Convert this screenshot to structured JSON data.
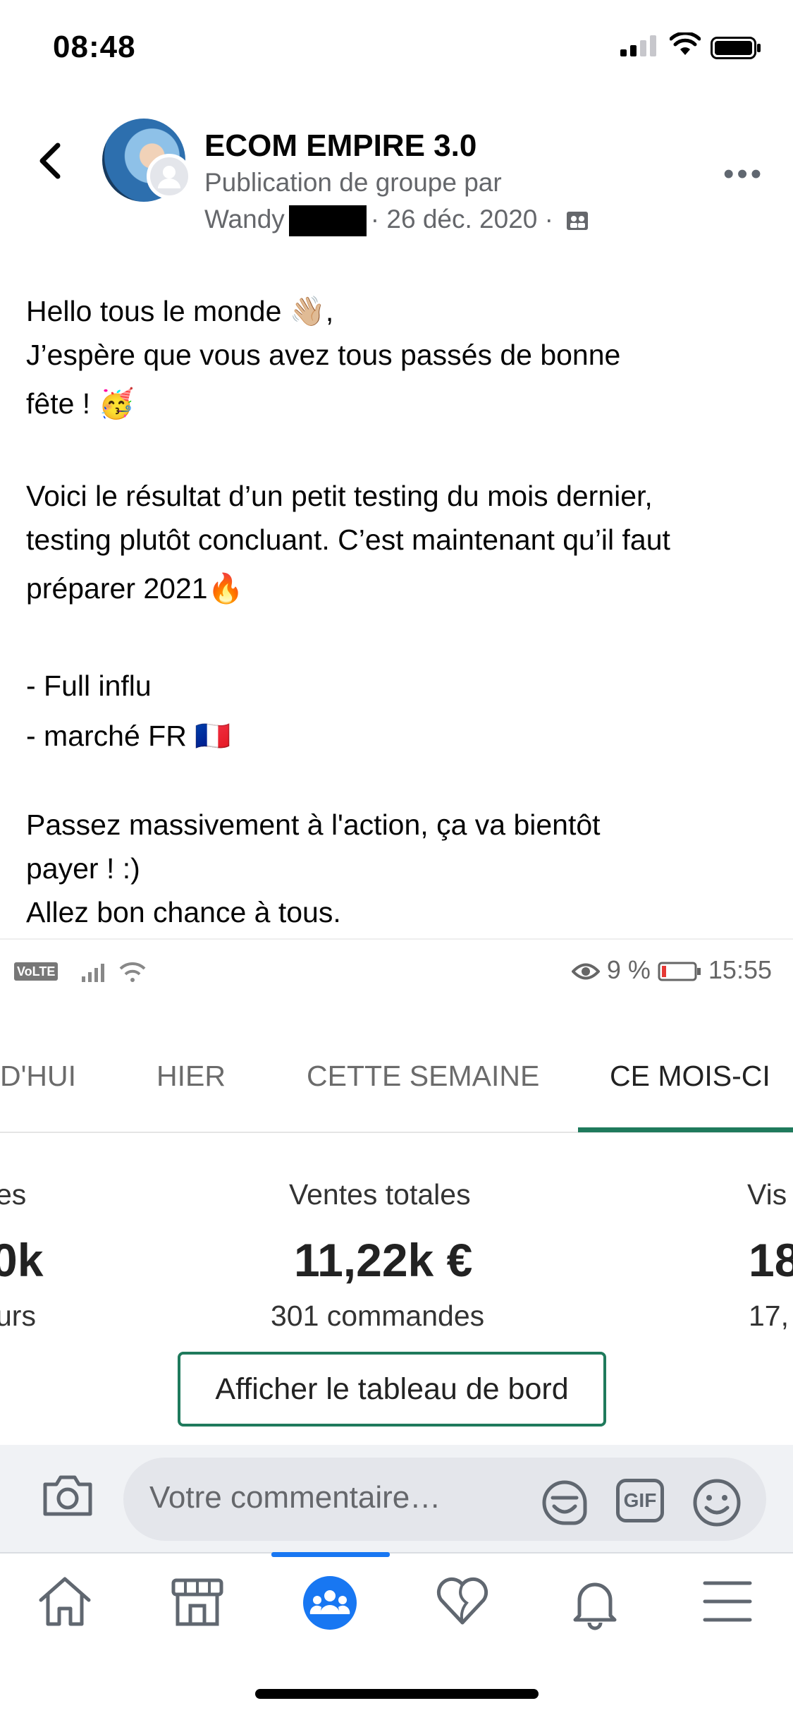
{
  "status_bar": {
    "time": "08:48"
  },
  "post": {
    "group_name": "ECOM EMPIRE 3.0",
    "subtitle": "Publication de groupe par",
    "author": "Wandy",
    "date_line": "· 26 déc. 2020 ·",
    "body": {
      "l1": "Hello tous le monde 👋🏼,",
      "l2": "J’espère que vous avez tous passés de bonne",
      "l3": "fête ! 🥳",
      "l4": "Voici le résultat d’un petit testing du mois dernier,",
      "l5": "testing plutôt concluant. C’est maintenant qu’il faut",
      "l6": "préparer 2021🔥",
      "l7": "- Full influ",
      "l8": "- marché FR 🇫🇷",
      "l9": "Passez massivement à l'action, ça va bientôt",
      "l10": "payer ! :)",
      "l11": "Allez bon chance à tous."
    }
  },
  "embed": {
    "status_left": "VoLTE",
    "battery_pct": "9 %",
    "time": "15:55",
    "tabs": {
      "today": "D'HUI",
      "yesterday": "HIER",
      "this_week": "CETTE SEMAINE",
      "this_month": "CE MOIS-CI"
    },
    "metrics": {
      "left": {
        "label": "es",
        "value": "0k",
        "sub": "urs"
      },
      "center": {
        "label": "Ventes totales",
        "value": "11,22k €",
        "sub": "301 commandes"
      },
      "right": {
        "label": "Vis",
        "value": "18",
        "sub": "17,"
      }
    },
    "dashboard_button": "Afficher le tableau de bord"
  },
  "comment_bar": {
    "placeholder": "Votre commentaire…",
    "gif_label": "GIF"
  },
  "colors": {
    "accent_green": "#1f7a5c",
    "fb_blue": "#1877f2"
  },
  "icons": [
    "back-icon",
    "more-icon",
    "camera-icon",
    "sticker-icon",
    "gif-icon",
    "emoji-icon",
    "home-icon",
    "marketplace-icon",
    "groups-icon",
    "dating-icon",
    "bell-icon",
    "menu-icon"
  ]
}
